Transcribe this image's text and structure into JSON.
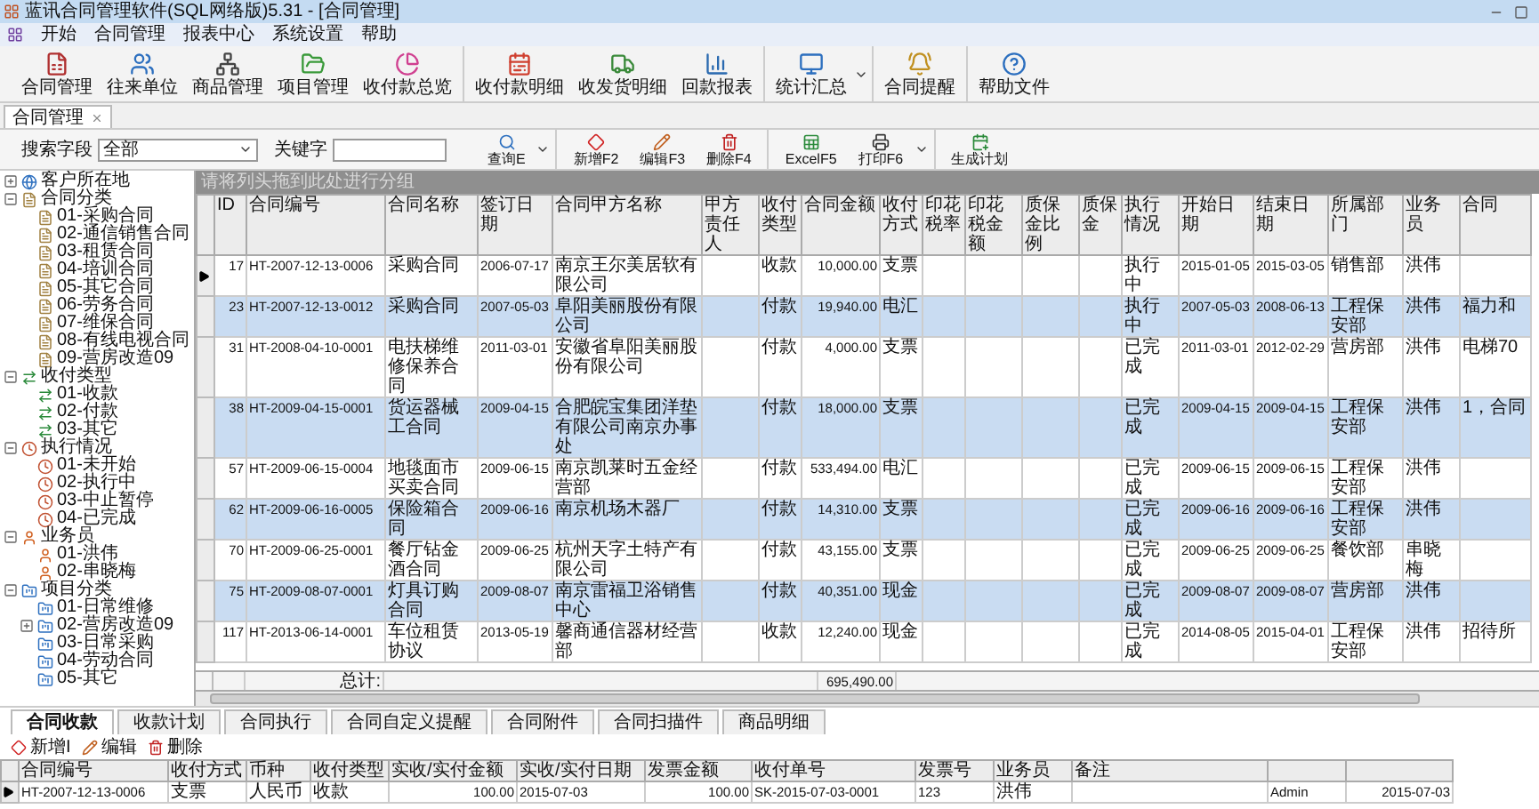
{
  "window": {
    "title": "蓝讯合同管理软件(SQL网络版)5.31 - [合同管理]"
  },
  "menu": [
    "开始",
    "合同管理",
    "报表中心",
    "系统设置",
    "帮助"
  ],
  "toolbar_groups": [
    [
      {
        "label": "合同管理",
        "kind": "button"
      },
      {
        "label": "往来单位",
        "kind": "button"
      },
      {
        "label": "商品管理",
        "kind": "button"
      },
      {
        "label": "项目管理",
        "kind": "button"
      },
      {
        "label": "收付款总览",
        "kind": "button"
      }
    ],
    [
      {
        "label": "收付款明细",
        "kind": "button"
      },
      {
        "label": "收发货明细",
        "kind": "button"
      },
      {
        "label": "回款报表",
        "kind": "button"
      }
    ],
    [
      {
        "label": "统计汇总",
        "kind": "split"
      }
    ],
    [
      {
        "label": "合同提醒",
        "kind": "button"
      }
    ],
    [
      {
        "label": "帮助文件",
        "kind": "button"
      }
    ]
  ],
  "doc_tabs": [
    {
      "label": "合同管理",
      "selected": true
    }
  ],
  "search": {
    "field_label": "搜索字段",
    "field_value": "全部",
    "keyword_label": "关键字"
  },
  "action_groups": [
    [
      {
        "label": "查询E",
        "kind": "split"
      }
    ],
    [
      {
        "label": "新增F2",
        "kind": "button"
      },
      {
        "label": "编辑F3",
        "kind": "button"
      },
      {
        "label": "删除F4",
        "kind": "button"
      }
    ],
    [
      {
        "label": "ExcelF5",
        "kind": "button"
      },
      {
        "label": "打印F6",
        "kind": "split"
      }
    ],
    [
      {
        "label": "生成计划",
        "kind": "button"
      }
    ]
  ],
  "tree": [
    {
      "label": "客户所在地",
      "kind": "globe",
      "expanded": false
    },
    {
      "label": "合同分类",
      "kind": "doc",
      "expanded": true,
      "children": [
        {
          "label": "01-采购合同",
          "kind": "doc"
        },
        {
          "label": "02-通信销售合同",
          "kind": "doc"
        },
        {
          "label": "03-租赁合同",
          "kind": "doc"
        },
        {
          "label": "04-培训合同",
          "kind": "doc"
        },
        {
          "label": "05-其它合同",
          "kind": "doc"
        },
        {
          "label": "06-劳务合同",
          "kind": "doc"
        },
        {
          "label": "07-维保合同",
          "kind": "doc"
        },
        {
          "label": "08-有线电视合同",
          "kind": "doc"
        },
        {
          "label": "09-营房改造09",
          "kind": "doc"
        }
      ]
    },
    {
      "label": "收付类型",
      "kind": "transfer",
      "expanded": true,
      "children": [
        {
          "label": "01-收款",
          "kind": "transfer"
        },
        {
          "label": "02-付款",
          "kind": "transfer"
        },
        {
          "label": "03-其它",
          "kind": "transfer"
        }
      ]
    },
    {
      "label": "执行情况",
      "kind": "clock",
      "expanded": true,
      "children": [
        {
          "label": "01-未开始",
          "kind": "clock"
        },
        {
          "label": "02-执行中",
          "kind": "clock"
        },
        {
          "label": "03-中止暂停",
          "kind": "clock"
        },
        {
          "label": "04-已完成",
          "kind": "clock"
        }
      ]
    },
    {
      "label": "业务员",
      "kind": "person",
      "expanded": true,
      "children": [
        {
          "label": "01-洪伟",
          "kind": "person"
        },
        {
          "label": "02-串晓梅",
          "kind": "person"
        }
      ]
    },
    {
      "label": "项目分类",
      "kind": "project",
      "expanded": true,
      "children": [
        {
          "label": "01-日常维修",
          "kind": "project"
        },
        {
          "label": "02-营房改造09",
          "kind": "project",
          "expanded": false
        },
        {
          "label": "03-日常采购",
          "kind": "project"
        },
        {
          "label": "04-劳动合同",
          "kind": "project"
        },
        {
          "label": "05-其它",
          "kind": "project"
        }
      ]
    }
  ],
  "grid": {
    "group_hint": "请将列头拖到此处进行分组",
    "columns": [
      "ID",
      "合同编号",
      "合同名称",
      "签订日期",
      "合同甲方名称",
      "甲方责任人",
      "收付类型",
      "合同金额",
      "收付方式",
      "印花税率",
      "印花税金额",
      "质保金比例",
      "质保金",
      "执行情况",
      "开始日期",
      "结束日期",
      "所属部门",
      "业务员",
      "合同"
    ],
    "rows": [
      {
        "selected": true,
        "cells": [
          "17",
          "HT-2007-12-13-0006",
          "采购合同",
          "2006-07-17",
          "南京王尔美居软有限公司",
          null,
          "收款",
          "10,000.00",
          "支票",
          null,
          null,
          null,
          null,
          "执行中",
          "2015-01-05",
          "2015-03-05",
          "销售部",
          "洪伟",
          null
        ]
      },
      {
        "selected": false,
        "cells": [
          "23",
          "HT-2007-12-13-0012",
          "采购合同",
          "2007-05-03",
          "阜阳美丽股份有限公司",
          null,
          "付款",
          "19,940.00",
          "电汇",
          null,
          null,
          null,
          null,
          "执行中",
          "2007-05-03",
          "2008-06-13",
          "工程保安部",
          "洪伟",
          "福力和"
        ]
      },
      {
        "selected": false,
        "cells": [
          "31",
          "HT-2008-04-10-0001",
          "电扶梯维修保养合同",
          "2011-03-01",
          "安徽省阜阳美丽股份有限公司",
          null,
          "付款",
          "4,000.00",
          "支票",
          null,
          null,
          null,
          null,
          "已完成",
          "2011-03-01",
          "2012-02-29",
          "营房部",
          "洪伟",
          "电梯70"
        ]
      },
      {
        "selected": false,
        "cells": [
          "38",
          "HT-2009-04-15-0001",
          "货运器械工合同",
          "2009-04-15",
          "合肥皖宝集团洋垫有限公司南京办事处",
          null,
          "付款",
          "18,000.00",
          "支票",
          null,
          null,
          null,
          null,
          "已完成",
          "2009-04-15",
          "2009-04-15",
          "工程保安部",
          "洪伟",
          "1，合同"
        ]
      },
      {
        "selected": false,
        "cells": [
          "57",
          "HT-2009-06-15-0004",
          "地毯面市买卖合同",
          "2009-06-15",
          "南京凯莱时五金经营部",
          null,
          "付款",
          "533,494.00",
          "电汇",
          null,
          null,
          null,
          null,
          "已完成",
          "2009-06-15",
          "2009-06-15",
          "工程保安部",
          "洪伟",
          null
        ]
      },
      {
        "selected": false,
        "cells": [
          "62",
          "HT-2009-06-16-0005",
          "保险箱合同",
          "2009-06-16",
          "南京机场木器厂",
          null,
          "付款",
          "14,310.00",
          "支票",
          null,
          null,
          null,
          null,
          "已完成",
          "2009-06-16",
          "2009-06-16",
          "工程保安部",
          "洪伟",
          null
        ]
      },
      {
        "selected": false,
        "cells": [
          "70",
          "HT-2009-06-25-0001",
          "餐厅钻金酒合同",
          "2009-06-25",
          "杭州天字土特产有限公司",
          null,
          "付款",
          "43,155.00",
          "支票",
          null,
          null,
          null,
          null,
          "已完成",
          "2009-06-25",
          "2009-06-25",
          "餐饮部",
          "串晓梅",
          null
        ]
      },
      {
        "selected": false,
        "cells": [
          "75",
          "HT-2009-08-07-0001",
          "灯具订购合同",
          "2009-08-07",
          "南京雷福卫浴销售中心",
          null,
          "付款",
          "40,351.00",
          "现金",
          null,
          null,
          null,
          null,
          "已完成",
          "2009-08-07",
          "2009-08-07",
          "营房部",
          "洪伟",
          null
        ]
      },
      {
        "selected": false,
        "cells": [
          "117",
          "HT-2013-06-14-0001",
          "车位租赁协议",
          "2013-05-19",
          "馨商通信器材经营部",
          null,
          "收款",
          "12,240.00",
          "现金",
          null,
          null,
          null,
          null,
          "已完成",
          "2014-08-05",
          "2015-04-01",
          "工程保安部",
          "洪伟",
          "招待所"
        ]
      }
    ],
    "total_label": "总计:",
    "total_value": "695,490.00"
  },
  "detail_tabs": [
    {
      "label": "合同收款",
      "selected": true
    },
    {
      "label": "收款计划",
      "selected": false
    },
    {
      "label": "合同执行",
      "selected": false
    },
    {
      "label": "合同自定义提醒",
      "selected": false
    },
    {
      "label": "合同附件",
      "selected": false
    },
    {
      "label": "合同扫描件",
      "selected": false
    },
    {
      "label": "商品明细",
      "selected": false
    }
  ],
  "detail_actions": [
    "新增I",
    "编辑",
    "删除"
  ],
  "detail_grid": {
    "columns": [
      "合同编号",
      "收付方式",
      "币种",
      "收付类型",
      "实收/实付金额",
      "实收/实付日期",
      "发票金额",
      "收付单号",
      "发票号",
      "业务员",
      "备注"
    ],
    "rows": [
      {
        "selected": true,
        "cells": [
          "HT-2007-12-13-0006",
          "支票",
          "人民币",
          "收款",
          "100.00",
          "2015-07-03",
          "100.00",
          "SK-2015-07-03-0001",
          "123",
          "洪伟",
          null,
          "Admin",
          "2015-07-03"
        ]
      }
    ]
  }
}
